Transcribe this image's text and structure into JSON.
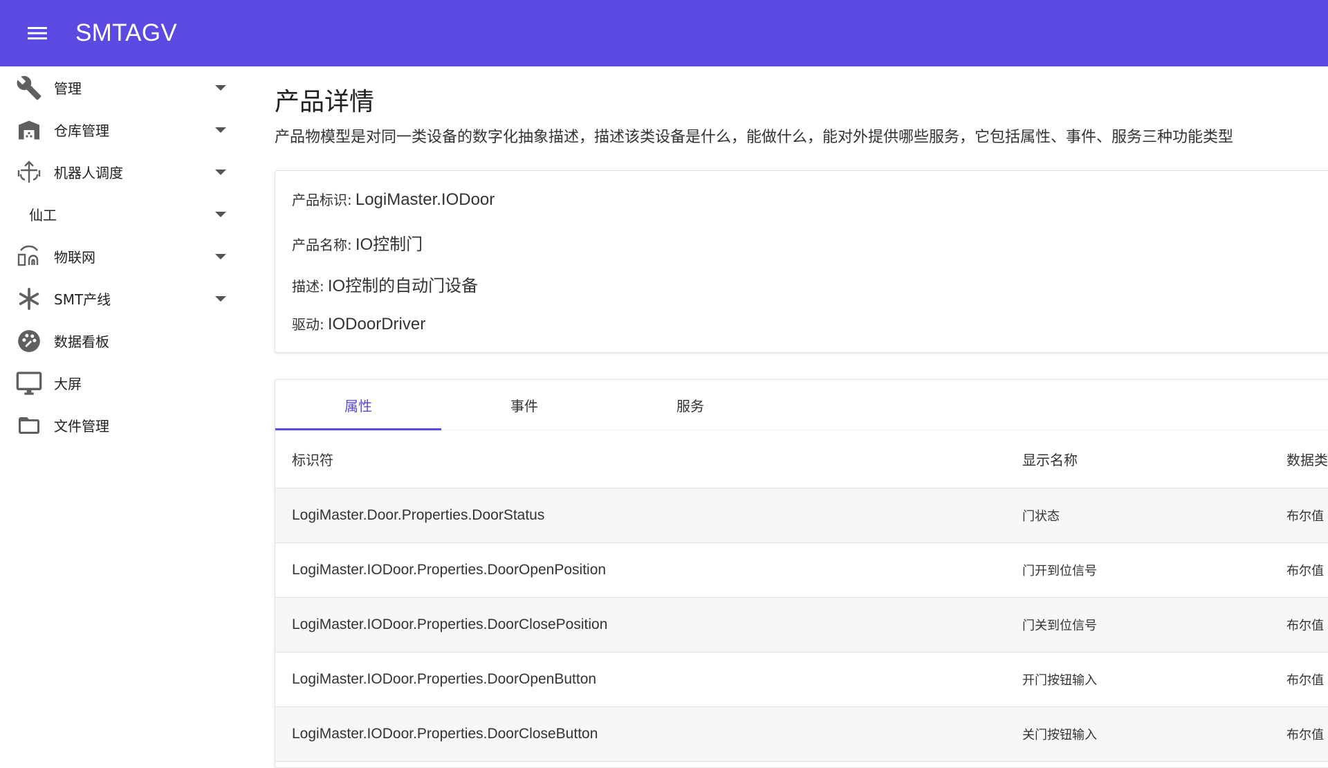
{
  "app": {
    "title": "SMTAGV"
  },
  "sidebar": {
    "items": [
      {
        "label": "管理",
        "icon": "wrench-icon",
        "has_caret": true
      },
      {
        "label": "仓库管理",
        "icon": "warehouse-icon",
        "has_caret": true
      },
      {
        "label": "机器人调度",
        "icon": "robot-dispatch-icon",
        "has_caret": true
      },
      {
        "label": "仙工",
        "icon": "",
        "has_caret": true
      },
      {
        "label": "物联网",
        "icon": "iot-icon",
        "has_caret": true
      },
      {
        "label": "SMT产线",
        "icon": "asterisk-icon",
        "has_caret": true
      },
      {
        "label": "数据看板",
        "icon": "palette-icon",
        "has_caret": false
      },
      {
        "label": "大屏",
        "icon": "monitor-icon",
        "has_caret": false
      },
      {
        "label": "文件管理",
        "icon": "folder-icon",
        "has_caret": false
      }
    ]
  },
  "page": {
    "title": "产品详情",
    "description": "产品物模型是对同一类设备的数字化抽象描述，描述该类设备是什么，能做什么，能对外提供哪些服务，它包括属性、事件、服务三种功能类型"
  },
  "product": {
    "id_label": "产品标识:",
    "id_value": "LogiMaster.IODoor",
    "name_label": "产品名称:",
    "name_value": "IO控制门",
    "desc_label": "描述:",
    "desc_value": "IO控制的自动门设备",
    "driver_label": "驱动:",
    "driver_value": "IODoorDriver"
  },
  "tabs": [
    {
      "label": "属性",
      "active": true
    },
    {
      "label": "事件",
      "active": false
    },
    {
      "label": "服务",
      "active": false
    }
  ],
  "table": {
    "columns": [
      "标识符",
      "显示名称",
      "数据类型"
    ],
    "rows": [
      [
        "LogiMaster.Door.Properties.DoorStatus",
        "门状态",
        "布尔值"
      ],
      [
        "LogiMaster.IODoor.Properties.DoorOpenPosition",
        "门开到位信号",
        "布尔值"
      ],
      [
        "LogiMaster.IODoor.Properties.DoorClosePosition",
        "门关到位信号",
        "布尔值"
      ],
      [
        "LogiMaster.IODoor.Properties.DoorOpenButton",
        "开门按钮输入",
        "布尔值"
      ],
      [
        "LogiMaster.IODoor.Properties.DoorCloseButton",
        "关门按钮输入",
        "布尔值"
      ]
    ]
  },
  "colors": {
    "primary": "#5b4ae1",
    "row_alt": "#f7f7f7"
  }
}
